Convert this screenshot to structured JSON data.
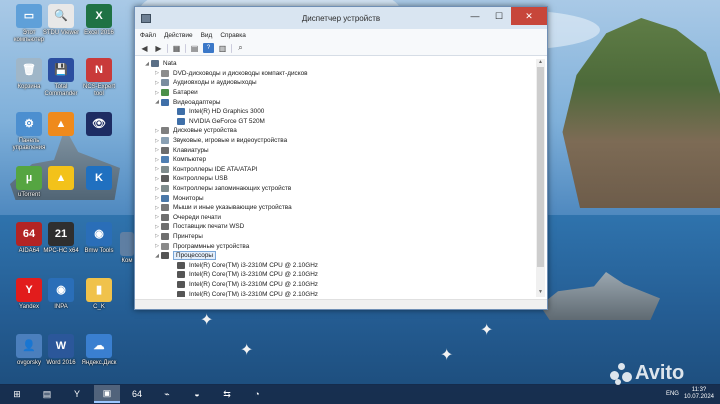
{
  "desktop": {
    "icons": [
      {
        "label": "Этот\nкомпьютер",
        "icon": "computer-icon",
        "color": "#5fa0d9",
        "glyph": "▭"
      },
      {
        "label": "STDU Viewer",
        "icon": "stdu-icon",
        "color": "#e8e8e8",
        "glyph": "🔍"
      },
      {
        "label": "Excel 2016",
        "icon": "excel-icon",
        "color": "#1f7244",
        "glyph": "X"
      },
      {
        "label": "Корзина",
        "icon": "recycle-bin-icon",
        "color": "#9fb6c8",
        "glyph": "🗑"
      },
      {
        "label": "Total\nCommander",
        "icon": "total-commander-icon",
        "color": "#2b4ea0",
        "glyph": "💾"
      },
      {
        "label": "NCS-Expert\ntool",
        "icon": "ncs-expert-icon",
        "color": "#c93a3a",
        "glyph": "N"
      },
      {
        "label": "Панель\nуправления",
        "icon": "control-panel-icon",
        "color": "#4c8fd0",
        "glyph": "⚙"
      },
      {
        "label": "",
        "icon": "vlc-icon",
        "color": "#ef8a1c",
        "glyph": "▲"
      },
      {
        "label": "",
        "icon": "eye-icon",
        "color": "#1d2c63",
        "glyph": "👁"
      },
      {
        "label": "uTorrent",
        "icon": "utorrent-icon",
        "color": "#55a541",
        "glyph": "µ"
      },
      {
        "label": "",
        "icon": "arrow-app-icon",
        "color": "#f3c21a",
        "glyph": "▲"
      },
      {
        "label": "",
        "icon": "kfp-icon",
        "color": "#2070c0",
        "glyph": "K"
      },
      {
        "label": "AIDA64",
        "icon": "aida64-icon",
        "color": "#b32424",
        "glyph": "64"
      },
      {
        "label": "MPC-HC x64",
        "icon": "mpc-hc-icon",
        "color": "#2f2f2f",
        "glyph": "21"
      },
      {
        "label": "Bmw Tools",
        "icon": "bmw-tools-icon",
        "color": "#2a6eb8",
        "glyph": "◉"
      },
      {
        "label": "Yandex",
        "icon": "yandex-icon",
        "color": "#e21c1c",
        "glyph": "Y"
      },
      {
        "label": "INPA",
        "icon": "inpa-icon",
        "color": "#2a6eb8",
        "glyph": "◉"
      },
      {
        "label": "C_K",
        "icon": "folder-icon",
        "color": "#f0c24b",
        "glyph": "▮"
      },
      {
        "label": "ovgorsky",
        "icon": "user-folder-icon",
        "color": "#4b7fbd",
        "glyph": "👤"
      },
      {
        "label": "Word 2016",
        "icon": "word-icon",
        "color": "#2b579a",
        "glyph": "W"
      },
      {
        "label": "Яндекс.Диск",
        "icon": "yandex-disk-icon",
        "color": "#3a7fd0",
        "glyph": "☁"
      }
    ],
    "partial_label": "Ком"
  },
  "window": {
    "title": "Диспетчер устройств",
    "menu": [
      "Файл",
      "Действие",
      "Вид",
      "Справка"
    ],
    "buttons": {
      "minimize": "—",
      "maximize": "☐",
      "close": "✕"
    }
  },
  "tree": [
    {
      "level": 0,
      "label": "Nata",
      "expanded": true,
      "icon": "computer-root-icon",
      "color": "#5b6f86"
    },
    {
      "level": 1,
      "label": "DVD-дисководы и дисководы компакт-дисков",
      "expanded": false,
      "icon": "dvd-drive-icon",
      "color": "#8c8c8c"
    },
    {
      "level": 1,
      "label": "Аудиовходы и аудиовыходы",
      "expanded": false,
      "icon": "audio-io-icon",
      "color": "#7a8d9f"
    },
    {
      "level": 1,
      "label": "Батареи",
      "expanded": false,
      "icon": "battery-icon",
      "color": "#4a8f4a"
    },
    {
      "level": 1,
      "label": "Видеоадаптеры",
      "expanded": true,
      "icon": "display-adapter-icon",
      "color": "#3f6fa8"
    },
    {
      "level": 2,
      "label": "Intel(R) HD Graphics 3000",
      "icon": "display-adapter-icon",
      "color": "#3f6fa8"
    },
    {
      "level": 2,
      "label": "NVIDIA GeForce GT 520M",
      "icon": "display-adapter-icon",
      "color": "#3f6fa8"
    },
    {
      "level": 1,
      "label": "Дисковые устройства",
      "expanded": false,
      "icon": "disk-drive-icon",
      "color": "#7f7f7f"
    },
    {
      "level": 1,
      "label": "Звуковые, игровые и видеоустройства",
      "expanded": false,
      "icon": "sound-icon",
      "color": "#8aa0b3"
    },
    {
      "level": 1,
      "label": "Клавиатуры",
      "expanded": false,
      "icon": "keyboard-icon",
      "color": "#6d6d6d"
    },
    {
      "level": 1,
      "label": "Компьютер",
      "expanded": false,
      "icon": "computer-icon",
      "color": "#4f7fb3"
    },
    {
      "level": 1,
      "label": "Контроллеры IDE ATA/ATAPI",
      "expanded": false,
      "icon": "ide-controller-icon",
      "color": "#7f8c8d"
    },
    {
      "level": 1,
      "label": "Контроллеры USB",
      "expanded": false,
      "icon": "usb-icon",
      "color": "#5c5c5c"
    },
    {
      "level": 1,
      "label": "Контроллеры запоминающих устройств",
      "expanded": false,
      "icon": "storage-controller-icon",
      "color": "#7f8c8d"
    },
    {
      "level": 1,
      "label": "Мониторы",
      "expanded": false,
      "icon": "monitor-icon",
      "color": "#4a78a8"
    },
    {
      "level": 1,
      "label": "Мыши и иные указывающие устройства",
      "expanded": false,
      "icon": "mouse-icon",
      "color": "#777777"
    },
    {
      "level": 1,
      "label": "Очереди печати",
      "expanded": false,
      "icon": "print-queue-icon",
      "color": "#6f6f6f"
    },
    {
      "level": 1,
      "label": "Поставщик печати WSD",
      "expanded": false,
      "icon": "wsd-printer-icon",
      "color": "#6f6f6f"
    },
    {
      "level": 1,
      "label": "Принтеры",
      "expanded": false,
      "icon": "printer-icon",
      "color": "#6f6f6f"
    },
    {
      "level": 1,
      "label": "Программные устройства",
      "expanded": false,
      "icon": "software-device-icon",
      "color": "#8a8a8a"
    },
    {
      "level": 1,
      "label": "Процессоры",
      "expanded": true,
      "selected": true,
      "icon": "processor-icon",
      "color": "#555555"
    },
    {
      "level": 2,
      "label": "Intel(R) Core(TM) i3-2310M CPU @ 2.10GHz",
      "icon": "processor-icon",
      "color": "#555555"
    },
    {
      "level": 2,
      "label": "Intel(R) Core(TM) i3-2310M CPU @ 2.10GHz",
      "icon": "processor-icon",
      "color": "#555555"
    },
    {
      "level": 2,
      "label": "Intel(R) Core(TM) i3-2310M CPU @ 2.10GHz",
      "icon": "processor-icon",
      "color": "#555555"
    },
    {
      "level": 2,
      "label": "Intel(R) Core(TM) i3-2310M CPU @ 2.10GHz",
      "icon": "processor-icon",
      "color": "#555555"
    }
  ],
  "taskbar": {
    "apps": [
      {
        "icon": "windows-start-icon",
        "glyph": "⊞"
      },
      {
        "icon": "file-explorer-icon",
        "glyph": "▤"
      },
      {
        "icon": "yandex-browser-icon",
        "glyph": "Y"
      },
      {
        "icon": "device-manager-icon",
        "glyph": "▣",
        "active": true
      },
      {
        "icon": "aida64-taskbar-icon",
        "glyph": "64"
      },
      {
        "icon": "usb-taskbar-icon",
        "glyph": "⌁"
      },
      {
        "icon": "disk-taskbar-icon",
        "glyph": "◒"
      },
      {
        "icon": "network-taskbar-icon",
        "glyph": "⇆"
      },
      {
        "icon": "speaker-taskbar-icon",
        "glyph": "◔"
      }
    ],
    "tray": {
      "language": "ENG",
      "time": "11:3?",
      "date": "10.07.2024"
    }
  },
  "watermark": "Avito"
}
